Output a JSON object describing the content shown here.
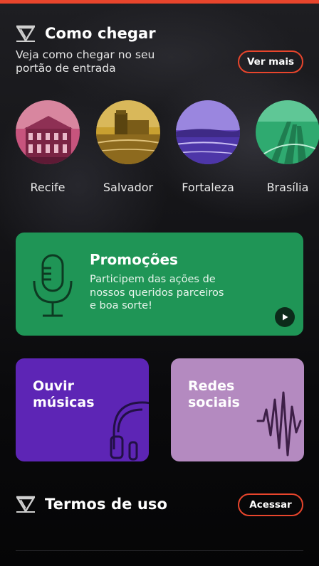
{
  "section_arrive": {
    "title": "Como chegar",
    "subtitle": "Veja como chegar no seu portão de entrada",
    "button_label": "Ver mais"
  },
  "cities": [
    {
      "label": "Recife",
      "color": "#c7547d"
    },
    {
      "label": "Salvador",
      "color": "#c9a030"
    },
    {
      "label": "Fortaleza",
      "color": "#6b4cc4"
    },
    {
      "label": "Brasília",
      "color": "#2faa70"
    }
  ],
  "promo": {
    "title": "Promoções",
    "text": "Participem das ações de nossos queridos parceiros e boa sorte!",
    "color": "#1f9556"
  },
  "cards": {
    "music": {
      "title": "Ouvir\nmúsicas",
      "color": "#5d25b5"
    },
    "social": {
      "title": "Redes\nsociais",
      "color": "#b48ac0"
    }
  },
  "section_terms": {
    "title": "Termos de uso",
    "button_label": "Acessar"
  },
  "accent_color": "#e8452c"
}
